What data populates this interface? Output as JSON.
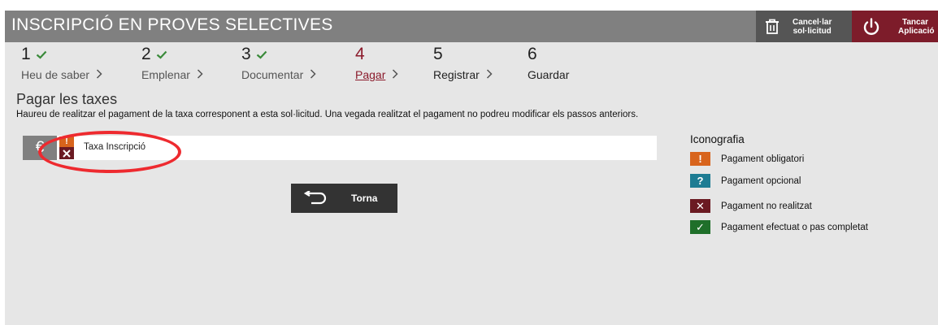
{
  "header": {
    "title": "INSCRIPCIÓ EN PROVES SELECTIVES",
    "cancel_label_1": "Cancel·lar",
    "cancel_label_2": "sol·licitud",
    "close_label_1": "Tancar",
    "close_label_2": "Aplicació"
  },
  "steps": [
    {
      "num": "1",
      "label": "Heu de saber",
      "state": "completed"
    },
    {
      "num": "2",
      "label": "Emplenar",
      "state": "completed"
    },
    {
      "num": "3",
      "label": "Documentar",
      "state": "completed"
    },
    {
      "num": "4",
      "label": "Pagar",
      "state": "current"
    },
    {
      "num": "5",
      "label": "Registrar",
      "state": "pending"
    },
    {
      "num": "6",
      "label": "Guardar",
      "state": "pending"
    }
  ],
  "section": {
    "title": "Pagar les taxes",
    "description": "Haureu de realitzar el pagament de la taxa corresponent a esta sol·licitud. Una vegada realitzat el pagament no podreu modificar els passos anteriors."
  },
  "fee": {
    "euro_symbol": "€",
    "label": "Taxa Inscripció",
    "status_top_glyph": "!"
  },
  "back_button": {
    "label": "Torna"
  },
  "legend": {
    "title": "Iconografia",
    "items": [
      {
        "glyph": "!",
        "label": "Pagament obligatori",
        "color": "#d8641c",
        "icon": "exclamation-icon"
      },
      {
        "glyph": "?",
        "label": "Pagament opcional",
        "color": "#1d7c93",
        "icon": "question-icon"
      },
      {
        "glyph": "✕",
        "label": "Pagament no realitzat",
        "color": "#6b1a22",
        "icon": "cross-icon"
      },
      {
        "glyph": "✓",
        "label": "Pagament efectuat o pas completat",
        "color": "#1f6f2a",
        "icon": "check-icon"
      }
    ]
  },
  "colors": {
    "header_bg": "#808080",
    "cancel_bg": "#555555",
    "close_bg": "#7d1c2a",
    "current_step": "#8b1a2b",
    "check_green": "#3a8a3a",
    "highlight_circle": "#ee2a2f"
  }
}
